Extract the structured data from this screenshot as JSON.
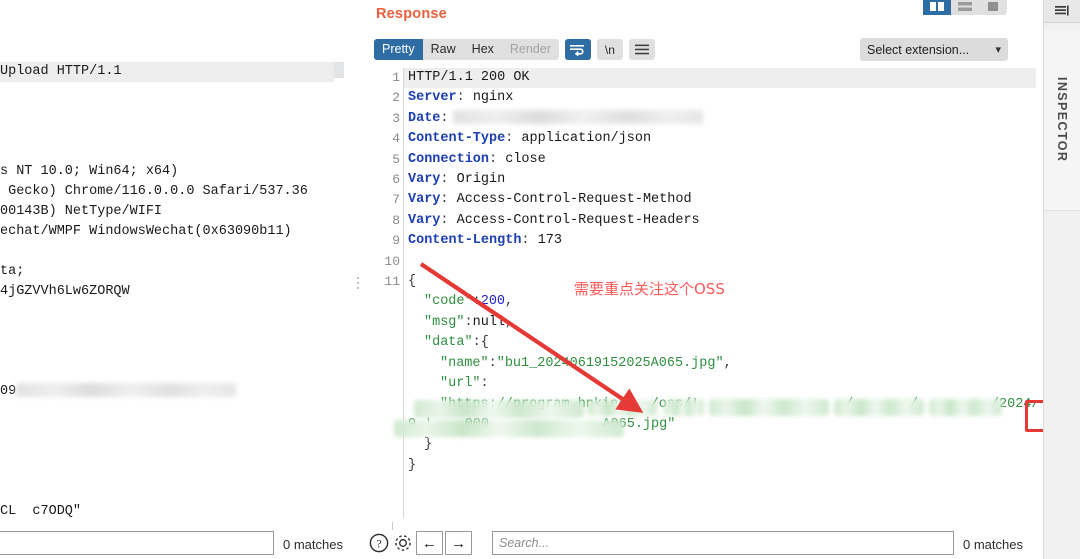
{
  "window": {
    "inspector_label": "INSPECTOR",
    "rail_icon": "panel-collapse-icon"
  },
  "left_panel": {
    "name": "request-panel",
    "scroll_note": "horizontally scrolled request view",
    "lines": [
      {
        "text": "Upload HTTP/1.1",
        "highlight": true
      },
      {
        "text": "",
        "highlight": false
      },
      {
        "text": "",
        "highlight": false
      },
      {
        "text": "",
        "highlight": false
      },
      {
        "text": "",
        "highlight": false
      },
      {
        "text": "s NT 10.0; Win64; x64)",
        "highlight": false
      },
      {
        "text": " Gecko) Chrome/116.0.0.0 Safari/537.36",
        "highlight": false
      },
      {
        "text": "00143B) NetType/WIFI",
        "highlight": false
      },
      {
        "text": "echat/WMPF WindowsWechat(0x63090b11)",
        "highlight": false
      },
      {
        "text": "",
        "highlight": false
      },
      {
        "text": "ta;",
        "highlight": false
      },
      {
        "text": "4jGZVVh6Lw6ZORQW",
        "highlight": false
      },
      {
        "text": "",
        "highlight": false
      },
      {
        "text": "",
        "highlight": false
      },
      {
        "text": "",
        "highlight": false
      },
      {
        "text": "",
        "highlight": false
      },
      {
        "text": "09",
        "highlight": false,
        "redacted": true
      },
      {
        "text": "",
        "highlight": false
      },
      {
        "text": "",
        "highlight": false
      },
      {
        "text": "",
        "highlight": false
      },
      {
        "text": "",
        "highlight": false
      },
      {
        "text": "",
        "highlight": false
      },
      {
        "text": "CL  c7ODQ\"",
        "highlight": false
      }
    ]
  },
  "response": {
    "title": "Response",
    "view_tabs": [
      {
        "label": "Pretty",
        "state": "active"
      },
      {
        "label": "Raw",
        "state": "normal"
      },
      {
        "label": "Hex",
        "state": "normal"
      },
      {
        "label": "Render",
        "state": "disabled"
      }
    ],
    "wrap_button": {
      "name": "word-wrap-icon",
      "label": ""
    },
    "newline_button": {
      "label": "\\n"
    },
    "menu_button": {
      "name": "hamburger-menu-icon",
      "label": ""
    },
    "layout_buttons": [
      {
        "name": "layout-vertical-split-icon",
        "state": "active"
      },
      {
        "name": "layout-horizontal-split-icon",
        "state": "normal"
      },
      {
        "name": "layout-single-pane-icon",
        "state": "normal"
      }
    ],
    "extension_select": {
      "value": "Select extension...",
      "chevron": "chevron-down-icon"
    },
    "status_line": "HTTP/1.1 200 OK",
    "headers": [
      {
        "num": 1,
        "raw": "HTTP/1.1 200 OK",
        "type": "status"
      },
      {
        "num": 2,
        "name": "Server",
        "value": " nginx",
        "type": "header"
      },
      {
        "num": 3,
        "name": "Date",
        "value": "",
        "type": "header",
        "redacted": true
      },
      {
        "num": 4,
        "name": "Content-Type",
        "value": " application/json",
        "type": "header"
      },
      {
        "num": 5,
        "name": "Connection",
        "value": " close",
        "type": "header"
      },
      {
        "num": 6,
        "name": "Vary",
        "value": " Origin",
        "type": "header"
      },
      {
        "num": 7,
        "name": "Vary",
        "value": " Access-Control-Request-Method",
        "type": "header"
      },
      {
        "num": 8,
        "name": "Vary",
        "value": " Access-Control-Request-Headers",
        "type": "header"
      },
      {
        "num": 9,
        "name": "Content-Length",
        "value": " 173",
        "type": "header"
      },
      {
        "num": 10,
        "raw": "",
        "type": "blank"
      }
    ],
    "body_start_line": 11,
    "body_lines": [
      {
        "indent": 0,
        "parts": [
          {
            "t": "{",
            "c": "punct"
          }
        ]
      },
      {
        "indent": 1,
        "parts": [
          {
            "t": "\"code\"",
            "c": "jkey"
          },
          {
            "t": ":",
            "c": "punct"
          },
          {
            "t": "200",
            "c": "jnum"
          },
          {
            "t": ",",
            "c": "punct"
          }
        ]
      },
      {
        "indent": 1,
        "parts": [
          {
            "t": "\"msg\"",
            "c": "jkey"
          },
          {
            "t": ":",
            "c": "punct"
          },
          {
            "t": "null",
            "c": "jnull"
          },
          {
            "t": ",",
            "c": "punct"
          }
        ]
      },
      {
        "indent": 1,
        "parts": [
          {
            "t": "\"data\"",
            "c": "jkey"
          },
          {
            "t": ":{",
            "c": "punct"
          }
        ]
      },
      {
        "indent": 2,
        "parts": [
          {
            "t": "\"name\"",
            "c": "jkey"
          },
          {
            "t": ":",
            "c": "punct"
          },
          {
            "t": "\"bu1_20240619152025A065.jpg\"",
            "c": "jstr"
          },
          {
            "t": ",",
            "c": "punct"
          }
        ]
      },
      {
        "indent": 2,
        "parts": [
          {
            "t": "\"url\"",
            "c": "jkey"
          },
          {
            "t": ":",
            "c": "punct"
          }
        ]
      },
      {
        "indent": 2,
        "parts": [
          {
            "t": "\"https://program.hnkiedu",
            "c": "jstr"
          },
          {
            "t": "  /oss/!",
            "c": "jstr"
          },
          {
            "t": "                  /       /         /2024/06/1",
            "c": "jstr"
          }
        ],
        "redacted_green": true
      },
      {
        "indent": 0,
        "parts": [
          {
            "t": "9 '    000              A065.jpg\"",
            "c": "jstr"
          }
        ],
        "redacted_green": true
      },
      {
        "indent": 1,
        "parts": [
          {
            "t": "}",
            "c": "punct"
          }
        ]
      },
      {
        "indent": 0,
        "parts": [
          {
            "t": "}",
            "c": "punct"
          }
        ]
      }
    ],
    "highlight_token": "/oss/!"
  },
  "annotations": {
    "note_text": "需要重点关注这个OSS",
    "note_color": "#ff5a5a",
    "arrow_color": "#e53935",
    "box_color": "#e53935"
  },
  "bottom_bar": {
    "left_search": {
      "placeholder": "",
      "value": ""
    },
    "left_matches": "0 matches",
    "help_button": {
      "name": "help-icon",
      "glyph": "?"
    },
    "settings_button": {
      "name": "gear-icon"
    },
    "prev_button": {
      "glyph": "←"
    },
    "next_button": {
      "glyph": "→"
    },
    "right_search": {
      "placeholder": "Search...",
      "value": ""
    },
    "right_matches": "0 matches"
  }
}
